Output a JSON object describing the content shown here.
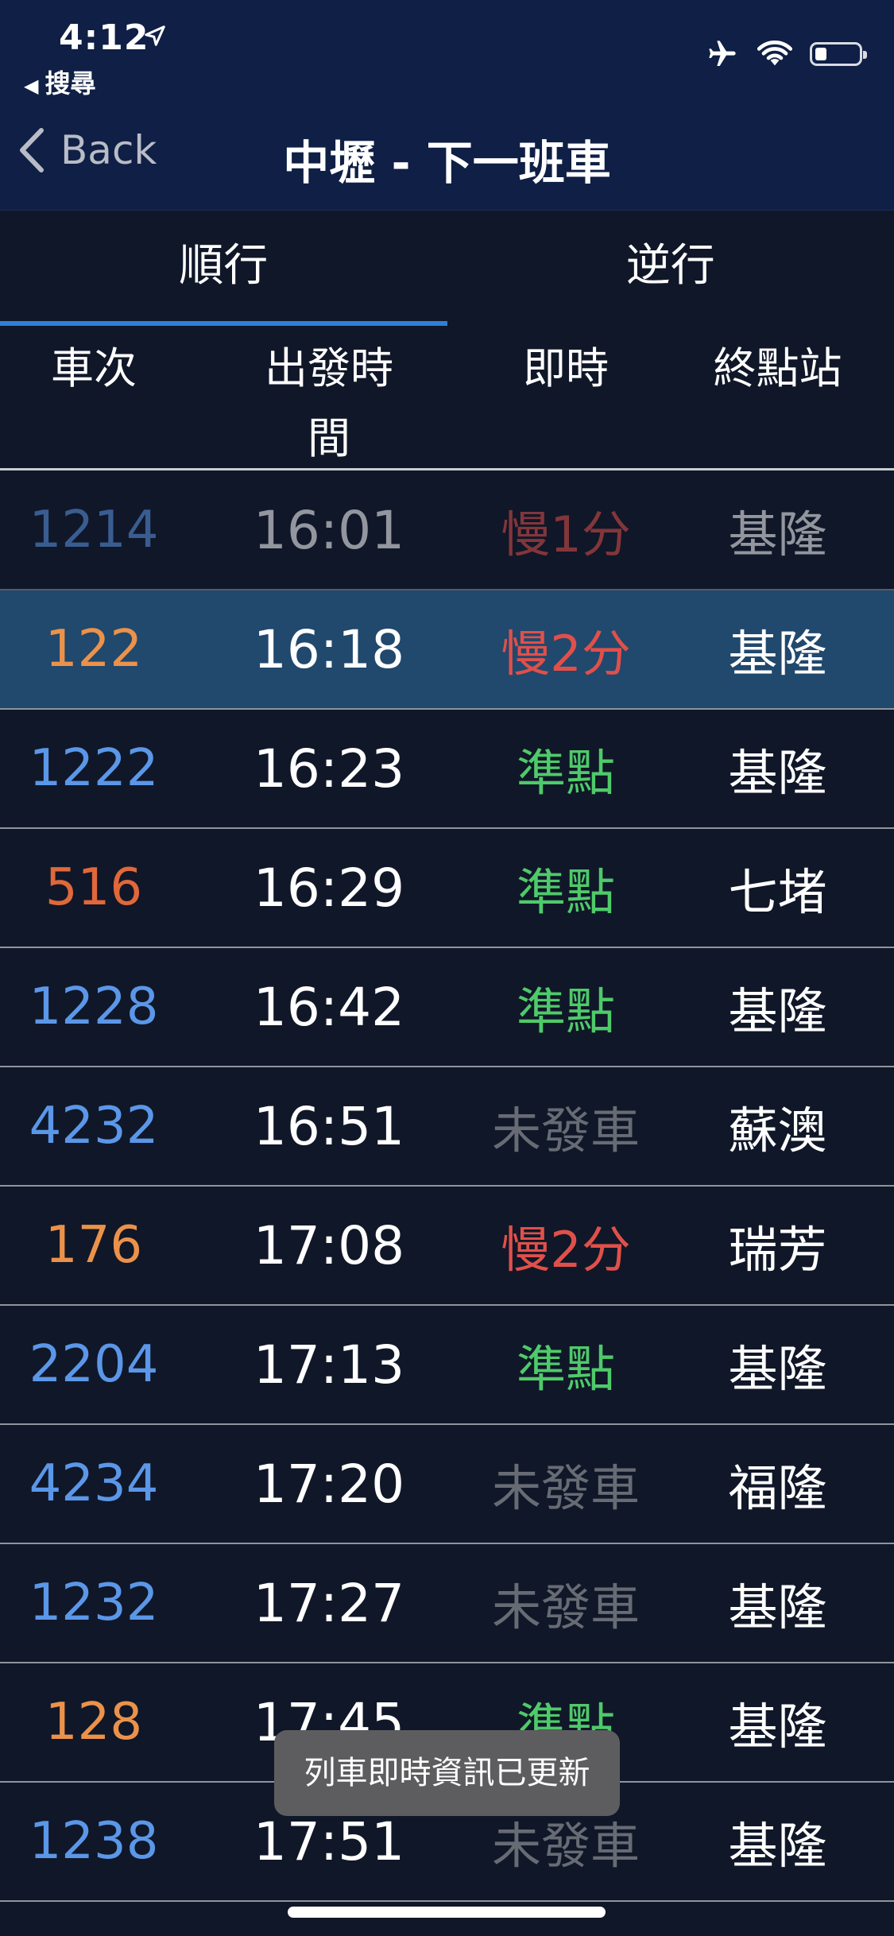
{
  "status_bar": {
    "time": "4:12",
    "back_app": "搜尋"
  },
  "nav": {
    "back_label": "Back",
    "title": "中壢 - 下一班車"
  },
  "tabs": [
    {
      "label": "順行",
      "active": true
    },
    {
      "label": "逆行",
      "active": false
    }
  ],
  "columns": {
    "train": "車次",
    "depart": "出發時間",
    "realtime": "即時",
    "destination": "終點站"
  },
  "colors": {
    "local_train": "#5b97e8",
    "express_train": "#eb924a",
    "express_train_alt": "#e0683a",
    "on_time": "#4fca6a",
    "delayed": "#e0504a",
    "not_departed": "#676b74",
    "highlight_row": "#21486d",
    "tab_indicator": "#2f7fd8"
  },
  "rows": [
    {
      "train": "1214",
      "time": "16:01",
      "status": "慢1分",
      "dest": "基隆",
      "train_color": "#5b97e8",
      "status_color": "#e0504a",
      "faded": true
    },
    {
      "train": "122",
      "time": "16:18",
      "status": "慢2分",
      "dest": "基隆",
      "train_color": "#eb924a",
      "status_color": "#e0504a",
      "highlight": true
    },
    {
      "train": "1222",
      "time": "16:23",
      "status": "準點",
      "dest": "基隆",
      "train_color": "#5b97e8",
      "status_color": "#4fca6a"
    },
    {
      "train": "516",
      "time": "16:29",
      "status": "準點",
      "dest": "七堵",
      "train_color": "#e0683a",
      "status_color": "#4fca6a"
    },
    {
      "train": "1228",
      "time": "16:42",
      "status": "準點",
      "dest": "基隆",
      "train_color": "#5b97e8",
      "status_color": "#4fca6a"
    },
    {
      "train": "4232",
      "time": "16:51",
      "status": "未發車",
      "dest": "蘇澳",
      "train_color": "#5b97e8",
      "status_color": "#676b74"
    },
    {
      "train": "176",
      "time": "17:08",
      "status": "慢2分",
      "dest": "瑞芳",
      "train_color": "#eb924a",
      "status_color": "#e0504a"
    },
    {
      "train": "2204",
      "time": "17:13",
      "status": "準點",
      "dest": "基隆",
      "train_color": "#5b97e8",
      "status_color": "#4fca6a"
    },
    {
      "train": "4234",
      "time": "17:20",
      "status": "未發車",
      "dest": "福隆",
      "train_color": "#5b97e8",
      "status_color": "#676b74"
    },
    {
      "train": "1232",
      "time": "17:27",
      "status": "未發車",
      "dest": "基隆",
      "train_color": "#5b97e8",
      "status_color": "#676b74"
    },
    {
      "train": "128",
      "time": "17:45",
      "status": "準點",
      "dest": "基隆",
      "train_color": "#eb924a",
      "status_color": "#4fca6a"
    },
    {
      "train": "1238",
      "time": "17:51",
      "status": "未發車",
      "dest": "基隆",
      "train_color": "#5b97e8",
      "status_color": "#676b74"
    }
  ],
  "toast": "列車即時資訊已更新"
}
